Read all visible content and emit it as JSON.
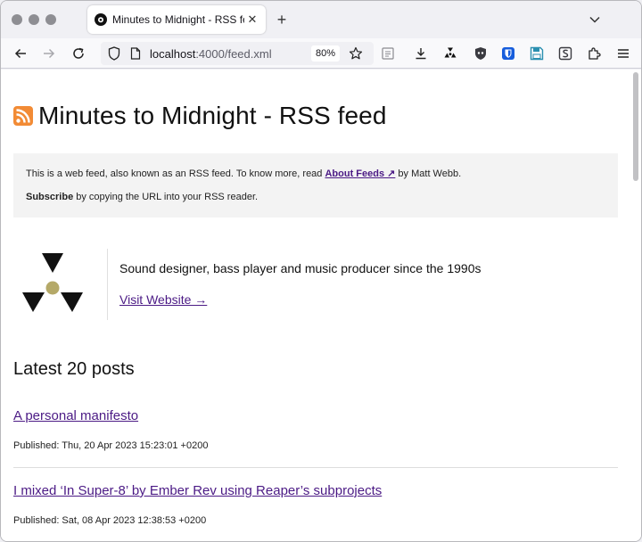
{
  "browser": {
    "tab": {
      "title": "Minutes to Midnight - RSS feed",
      "favicon": "radiation-icon"
    },
    "url": {
      "host": "localhost",
      "path": ":4000/feed.xml"
    },
    "zoom": "80%",
    "toolbar_icons": [
      "reader-view-icon",
      "downloads-icon",
      "radiation-extension-icon",
      "privacy-badger-icon",
      "bitwarden-icon",
      "save-icon",
      "s-extension-icon",
      "extensions-icon",
      "menu-icon"
    ]
  },
  "page": {
    "title": "Minutes to Midnight - RSS feed",
    "notice": {
      "line1_before": "This is a web feed, also known as an RSS feed. To know more, read ",
      "line1_link": "About Feeds ↗",
      "line1_after": " by Matt Webb.",
      "line2_bold": "Subscribe",
      "line2_rest": " by copying the URL into your RSS reader."
    },
    "profile": {
      "description": "Sound designer, bass player and music producer since the 1990s",
      "link": "Visit Website →"
    },
    "posts_heading": "Latest 20 posts",
    "posts": [
      {
        "title": "A personal manifesto",
        "published": "Published: Thu, 20 Apr 2023 15:23:01 +0200"
      },
      {
        "title": "I mixed ‘In Super-8’ by Ember Rev using Reaper’s subprojects",
        "published": "Published: Sat, 08 Apr 2023 12:38:53 +0200"
      }
    ]
  },
  "colors": {
    "link": "#4b1a85",
    "rss": "#f28b35",
    "notice_bg": "#f3f3f3",
    "logo_accent": "#b5a968"
  }
}
